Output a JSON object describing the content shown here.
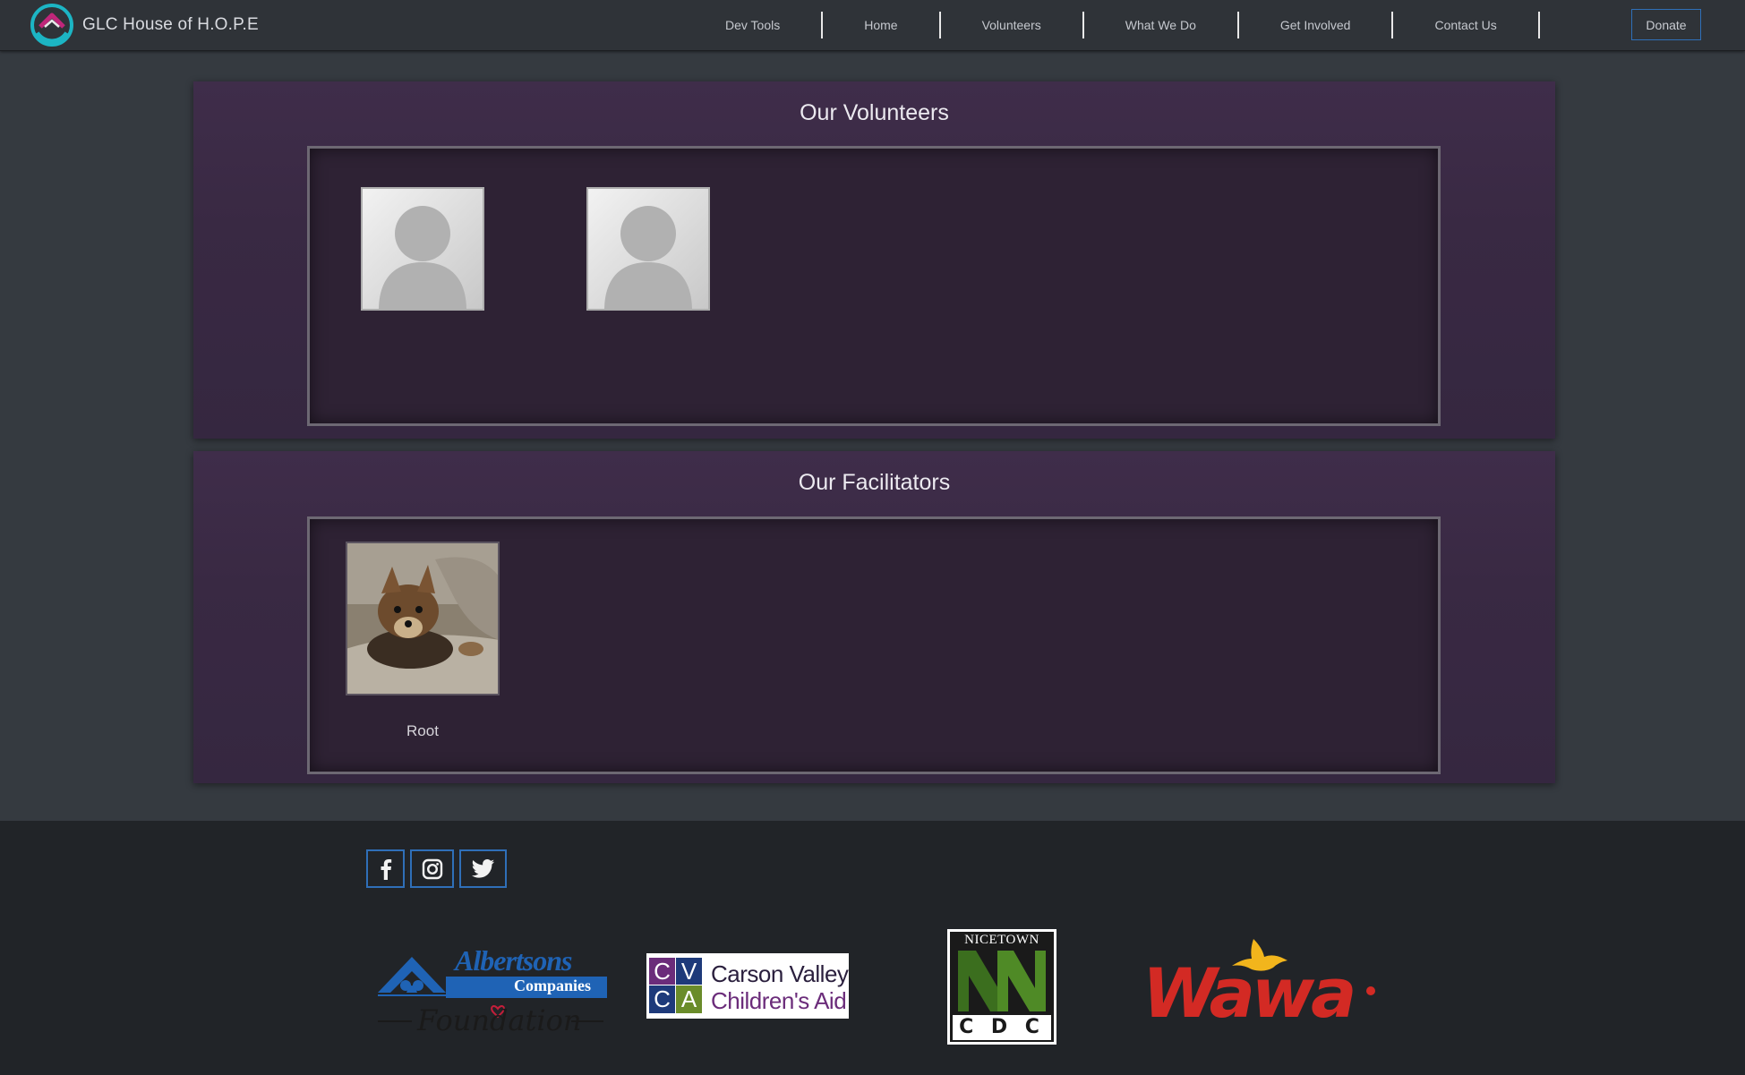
{
  "brand": {
    "name": "GLC House of H.O.P.E"
  },
  "nav": {
    "items": [
      "Dev Tools",
      "Home",
      "Volunteers",
      "What We Do",
      "Get Involved",
      "Contact Us"
    ],
    "donate_label": "Donate"
  },
  "volunteers": {
    "title": "Our Volunteers"
  },
  "facilitators": {
    "title": "Our Facilitators",
    "people": [
      {
        "name": "Root"
      }
    ]
  },
  "footer": {
    "social": [
      "facebook-icon",
      "instagram-icon",
      "twitter-icon"
    ],
    "sponsors": {
      "albertsons": {
        "line1": "Albertsons",
        "line2": "Companies",
        "line3": "Foundation"
      },
      "cvca": {
        "letters": [
          "C",
          "V",
          "C",
          "A"
        ],
        "line1": "Carson Valley",
        "line2": "Children's Aid"
      },
      "nicetown": {
        "top": "NICETOWN",
        "bottom": "C D C"
      },
      "wawa": {
        "name": "Wawa"
      }
    }
  },
  "colors": {
    "accent_blue": "#2f6fb8",
    "section_purple": "#3b2a45",
    "brand_teal": "#1cb5c4",
    "brand_magenta": "#c0267a"
  }
}
